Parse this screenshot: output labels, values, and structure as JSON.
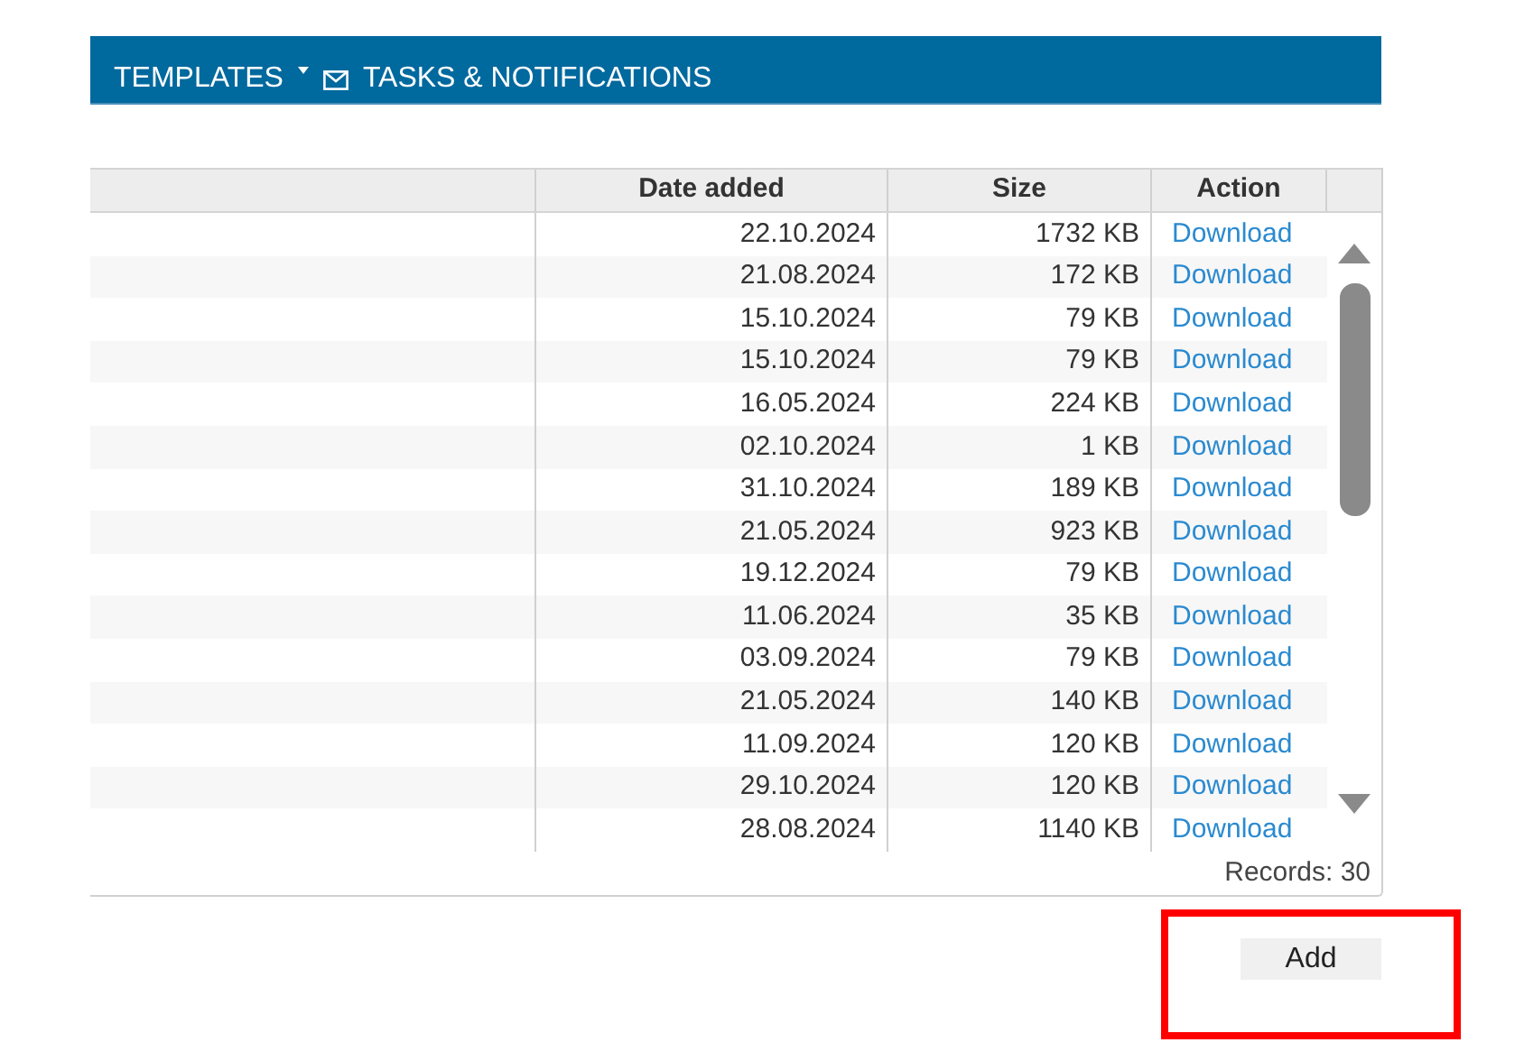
{
  "nav": {
    "items": [
      {
        "label": "TEMPLATES",
        "kind": "dropdown"
      },
      {
        "label": "TASKS & NOTIFICATIONS",
        "kind": "mail"
      }
    ]
  },
  "table": {
    "columns": [
      "Date added",
      "Size",
      "Action"
    ],
    "rows": [
      {
        "date": "22.10.2024",
        "size": "1732 KB",
        "action": "Download"
      },
      {
        "date": "21.08.2024",
        "size": "172 KB",
        "action": "Download"
      },
      {
        "date": "15.10.2024",
        "size": "79 KB",
        "action": "Download"
      },
      {
        "date": "15.10.2024",
        "size": "79 KB",
        "action": "Download"
      },
      {
        "date": "16.05.2024",
        "size": "224 KB",
        "action": "Download"
      },
      {
        "date": "02.10.2024",
        "size": "1 KB",
        "action": "Download"
      },
      {
        "date": "31.10.2024",
        "size": "189 KB",
        "action": "Download"
      },
      {
        "date": "21.05.2024",
        "size": "923 KB",
        "action": "Download"
      },
      {
        "date": "19.12.2024",
        "size": "79 KB",
        "action": "Download"
      },
      {
        "date": "11.06.2024",
        "size": "35 KB",
        "action": "Download"
      },
      {
        "date": "03.09.2024",
        "size": "79 KB",
        "action": "Download"
      },
      {
        "date": "21.05.2024",
        "size": "140 KB",
        "action": "Download"
      },
      {
        "date": "11.09.2024",
        "size": "120 KB",
        "action": "Download"
      },
      {
        "date": "29.10.2024",
        "size": "120 KB",
        "action": "Download"
      },
      {
        "date": "28.08.2024",
        "size": "1140 KB",
        "action": "Download"
      }
    ],
    "records": "Records: 30"
  },
  "add_button": "Add"
}
